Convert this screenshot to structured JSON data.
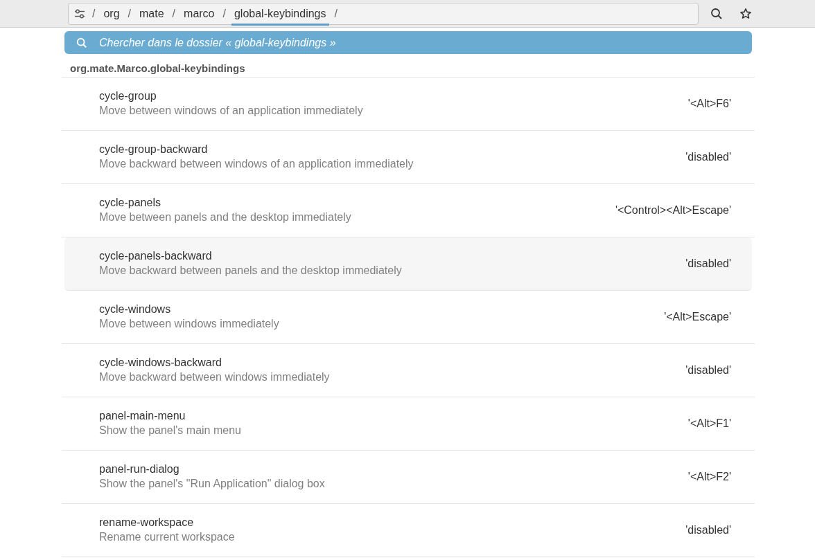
{
  "path_bar": {
    "crumbs": [
      {
        "label": "org",
        "selected": false
      },
      {
        "label": "mate",
        "selected": false
      },
      {
        "label": "marco",
        "selected": false
      },
      {
        "label": "global-keybindings",
        "selected": true
      }
    ],
    "separator": "/"
  },
  "search": {
    "placeholder": "Chercher dans le dossier « global-keybindings »"
  },
  "schema": "org.mate.Marco.global-keybindings",
  "keys": [
    {
      "name": "cycle-group",
      "description": "Move between windows of an application immediately",
      "value": "'<Alt>F6'",
      "selected": false
    },
    {
      "name": "cycle-group-backward",
      "description": "Move backward between windows of an application immediately",
      "value": "'disabled'",
      "selected": false
    },
    {
      "name": "cycle-panels",
      "description": "Move between panels and the desktop immediately",
      "value": "'<Control><Alt>Escape'",
      "selected": false
    },
    {
      "name": "cycle-panels-backward",
      "description": "Move backward between panels and the desktop immediately",
      "value": "'disabled'",
      "selected": true
    },
    {
      "name": "cycle-windows",
      "description": "Move between windows immediately",
      "value": "'<Alt>Escape'",
      "selected": false
    },
    {
      "name": "cycle-windows-backward",
      "description": "Move backward between windows immediately",
      "value": "'disabled'",
      "selected": false
    },
    {
      "name": "panel-main-menu",
      "description": "Show the panel's main menu",
      "value": "'<Alt>F1'",
      "selected": false
    },
    {
      "name": "panel-run-dialog",
      "description": "Show the panel's \"Run Application\" dialog box",
      "value": "'<Alt>F2'",
      "selected": false
    },
    {
      "name": "rename-workspace",
      "description": "Rename current workspace",
      "value": "'disabled'",
      "selected": false
    }
  ]
}
